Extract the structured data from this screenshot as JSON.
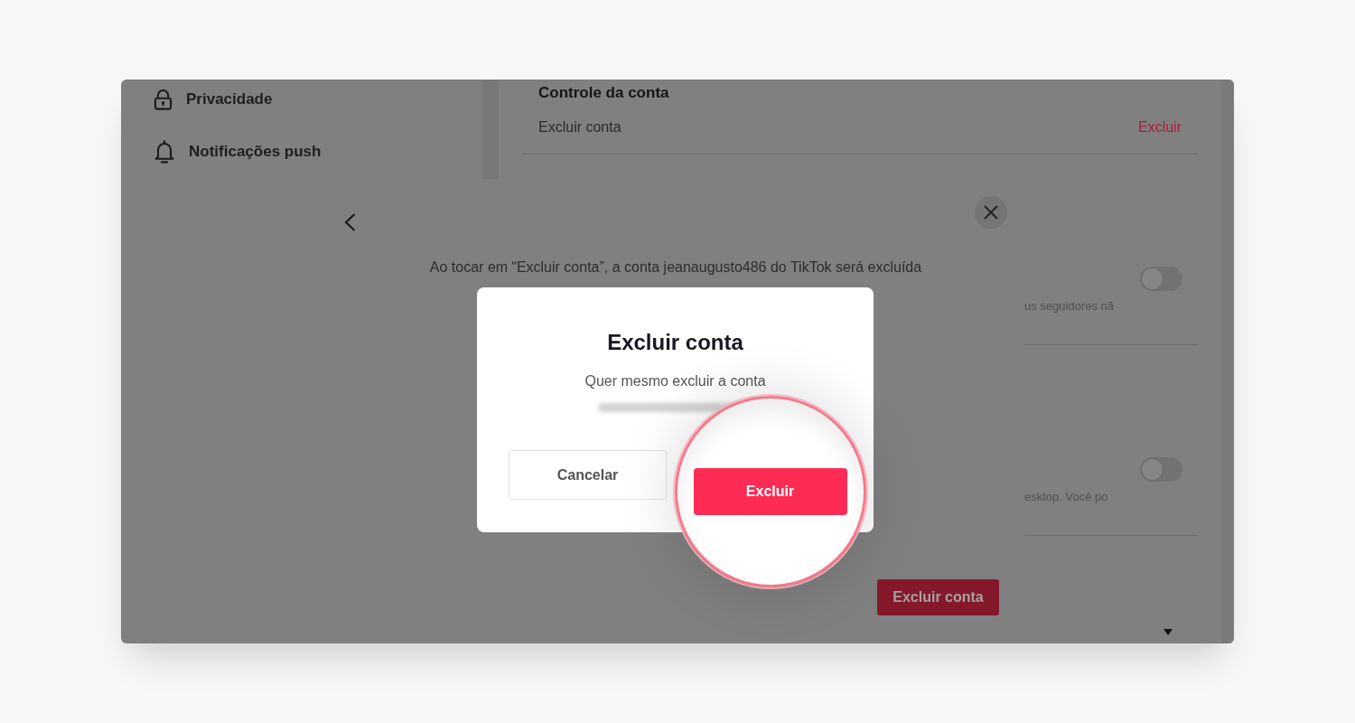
{
  "sidebar": {
    "items": [
      {
        "label": "Privacidade"
      },
      {
        "label": "Notificações push"
      }
    ]
  },
  "account_settings": {
    "title": "Controle da conta",
    "rows": [
      {
        "label": "Excluir conta",
        "action": "Excluir"
      }
    ],
    "toggle_rows": [
      {
        "description": "us seguidores nã",
        "on": false
      },
      {
        "description": "esktop. Você po",
        "on": false
      }
    ]
  },
  "delete_panel": {
    "message": "Ao tocar em “Excluir conta”, a conta jeanaugusto486 do TikTok será excluída",
    "button": "Excluir conta"
  },
  "confirm_dialog": {
    "title": "Excluir conta",
    "message": "Quer mesmo excluir a conta",
    "buttons": [
      {
        "label": "Cancelar",
        "kind": "secondary",
        "magnified": false
      },
      {
        "label": "Excluir",
        "kind": "primary",
        "magnified": true
      }
    ]
  }
}
